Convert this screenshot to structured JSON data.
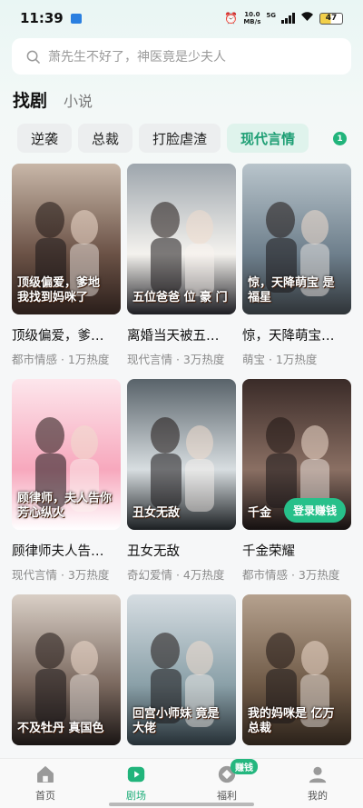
{
  "status_bar": {
    "time": "11:39",
    "net_speed_value": "10.0",
    "net_speed_unit": "MB/s",
    "network_gen": "5G",
    "battery": "47"
  },
  "search": {
    "placeholder": "萧先生不好了，神医竟是少夫人"
  },
  "top_tabs": [
    {
      "label": "找剧",
      "active": true
    },
    {
      "label": "小说",
      "active": false
    }
  ],
  "categories": [
    {
      "label": "逆袭"
    },
    {
      "label": "总裁"
    },
    {
      "label": "打脸虐渣"
    },
    {
      "label": "现代言情",
      "active": true
    }
  ],
  "category_badge": "1",
  "dramas": [
    {
      "title": "顶级偏爱，爹…",
      "tag": "都市情感",
      "heat": "1万热度",
      "poster_text": "顶级偏爱，爹地 我找到妈咪了",
      "colors": [
        "#c8b7a8",
        "#6b5246",
        "#2a1e1a"
      ]
    },
    {
      "title": "离婚当天被五…",
      "tag": "现代言情",
      "heat": "3万热度",
      "poster_text": "五位爸爸 位 豪 门",
      "colors": [
        "#9ea6ad",
        "#f4f2ee",
        "#1d1d22"
      ]
    },
    {
      "title": "惊，天降萌宝…",
      "tag": "萌宝",
      "heat": "1万热度",
      "poster_text": "惊，天降萌宝 是福星",
      "colors": [
        "#b8c4cb",
        "#6e7f8c",
        "#2f3438"
      ]
    },
    {
      "title": "顾律师夫人告…",
      "tag": "现代言情",
      "heat": "3万热度",
      "poster_text": "顾律师，夫人告你 芳心纵火",
      "colors": [
        "#fde6ec",
        "#f7a8bd",
        "#ffffff"
      ]
    },
    {
      "title": "丑女无敌",
      "tag": "奇幻爱情",
      "heat": "4万热度",
      "poster_text": "丑女无敌",
      "colors": [
        "#59636a",
        "#d7dde0",
        "#1b1f22"
      ]
    },
    {
      "title": "千金荣耀",
      "tag": "都市情感",
      "heat": "3万热度",
      "poster_text": "千金",
      "colors": [
        "#3a2b28",
        "#8a6f63",
        "#151010"
      ],
      "chip": "登录赚钱"
    },
    {
      "title": "",
      "tag": "",
      "heat": "",
      "poster_text": "不及牡丹 真国色",
      "colors": [
        "#d9cfc6",
        "#7a685e",
        "#1a1514"
      ]
    },
    {
      "title": "",
      "tag": "",
      "heat": "",
      "poster_text": "回宫小师妹 竟是大佬",
      "colors": [
        "#d6dde2",
        "#8aa0a8",
        "#263036"
      ]
    },
    {
      "title": "",
      "tag": "",
      "heat": "",
      "poster_text": "我的妈咪是 亿万总裁",
      "colors": [
        "#b5a18e",
        "#6f5a47",
        "#2b221a"
      ]
    }
  ],
  "bottom_nav": [
    {
      "label": "首页",
      "icon": "home-icon",
      "active": false
    },
    {
      "label": "剧场",
      "icon": "play-icon",
      "active": true
    },
    {
      "label": "福利",
      "icon": "coin-icon",
      "active": false,
      "badge": "赚钱"
    },
    {
      "label": "我的",
      "icon": "profile-icon",
      "active": false
    }
  ],
  "accent_color": "#21b47b"
}
